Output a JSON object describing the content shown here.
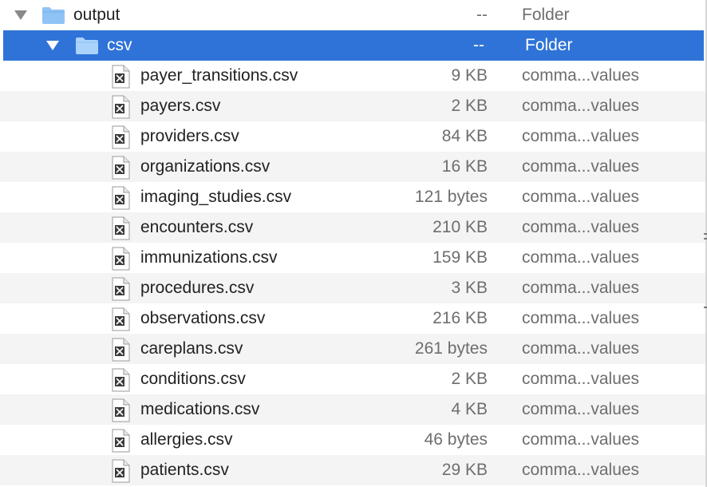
{
  "rows": [
    {
      "name": "output",
      "size": "--",
      "kind": "Folder"
    },
    {
      "name": "csv",
      "size": "--",
      "kind": "Folder"
    },
    {
      "name": "payer_transitions.csv",
      "size": "9 KB",
      "kind": "comma...values"
    },
    {
      "name": "payers.csv",
      "size": "2 KB",
      "kind": "comma...values"
    },
    {
      "name": "providers.csv",
      "size": "84 KB",
      "kind": "comma...values"
    },
    {
      "name": "organizations.csv",
      "size": "16 KB",
      "kind": "comma...values"
    },
    {
      "name": "imaging_studies.csv",
      "size": "121 bytes",
      "kind": "comma...values"
    },
    {
      "name": "encounters.csv",
      "size": "210 KB",
      "kind": "comma...values"
    },
    {
      "name": "immunizations.csv",
      "size": "159 KB",
      "kind": "comma...values"
    },
    {
      "name": "procedures.csv",
      "size": "3 KB",
      "kind": "comma...values"
    },
    {
      "name": "observations.csv",
      "size": "216 KB",
      "kind": "comma...values"
    },
    {
      "name": "careplans.csv",
      "size": "261 bytes",
      "kind": "comma...values"
    },
    {
      "name": "conditions.csv",
      "size": "2 KB",
      "kind": "comma...values"
    },
    {
      "name": "medications.csv",
      "size": "4 KB",
      "kind": "comma...values"
    },
    {
      "name": "allergies.csv",
      "size": "46 bytes",
      "kind": "comma...values"
    },
    {
      "name": "patients.csv",
      "size": "29 KB",
      "kind": "comma...values"
    }
  ],
  "icons": {
    "folder": "folder-icon",
    "file": "csv-file-icon",
    "disclosure": "disclosure-triangle-icon"
  },
  "colors": {
    "selection": "#2f73d8",
    "folder": "#8fc3f5",
    "stripe": "#f4f4f4",
    "secondary_text": "#6e6e6e"
  }
}
